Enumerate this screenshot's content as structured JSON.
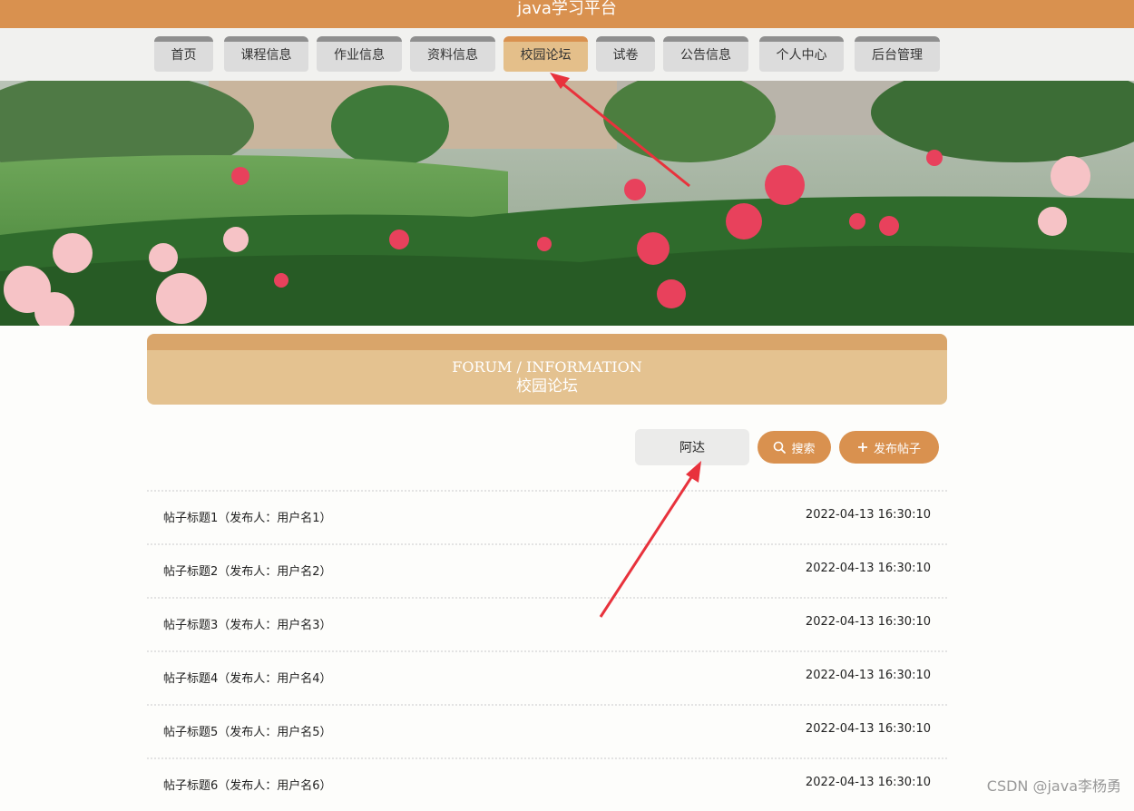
{
  "header": {
    "title": "java学习平台"
  },
  "nav": {
    "items": [
      {
        "label": "首页",
        "active": false
      },
      {
        "label": "课程信息",
        "active": false
      },
      {
        "label": "作业信息",
        "active": false
      },
      {
        "label": "资料信息",
        "active": false
      },
      {
        "label": "校园论坛",
        "active": true
      },
      {
        "label": "试卷",
        "active": false
      },
      {
        "label": "公告信息",
        "active": false
      },
      {
        "label": "个人中心",
        "active": false
      },
      {
        "label": "后台管理",
        "active": false
      }
    ]
  },
  "section": {
    "title_en": "FORUM / INFORMATION",
    "title_zh": "校园论坛"
  },
  "search": {
    "value": "阿达",
    "button_label": "搜索"
  },
  "publish": {
    "button_label": "发布帖子"
  },
  "posts": [
    {
      "title": "帖子标题1（发布人：用户名1）",
      "time": "2022-04-13 16:30:10"
    },
    {
      "title": "帖子标题2（发布人：用户名2）",
      "time": "2022-04-13 16:30:10"
    },
    {
      "title": "帖子标题3（发布人：用户名3）",
      "time": "2022-04-13 16:30:10"
    },
    {
      "title": "帖子标题4（发布人：用户名4）",
      "time": "2022-04-13 16:30:10"
    },
    {
      "title": "帖子标题5（发布人：用户名5）",
      "time": "2022-04-13 16:30:10"
    },
    {
      "title": "帖子标题6（发布人：用户名6）",
      "time": "2022-04-13 16:30:10"
    }
  ],
  "watermark": "CSDN @java李杨勇",
  "colors": {
    "accent": "#d9914f",
    "active_tab": "#e4bf8a",
    "annotation": "#e8323c"
  }
}
